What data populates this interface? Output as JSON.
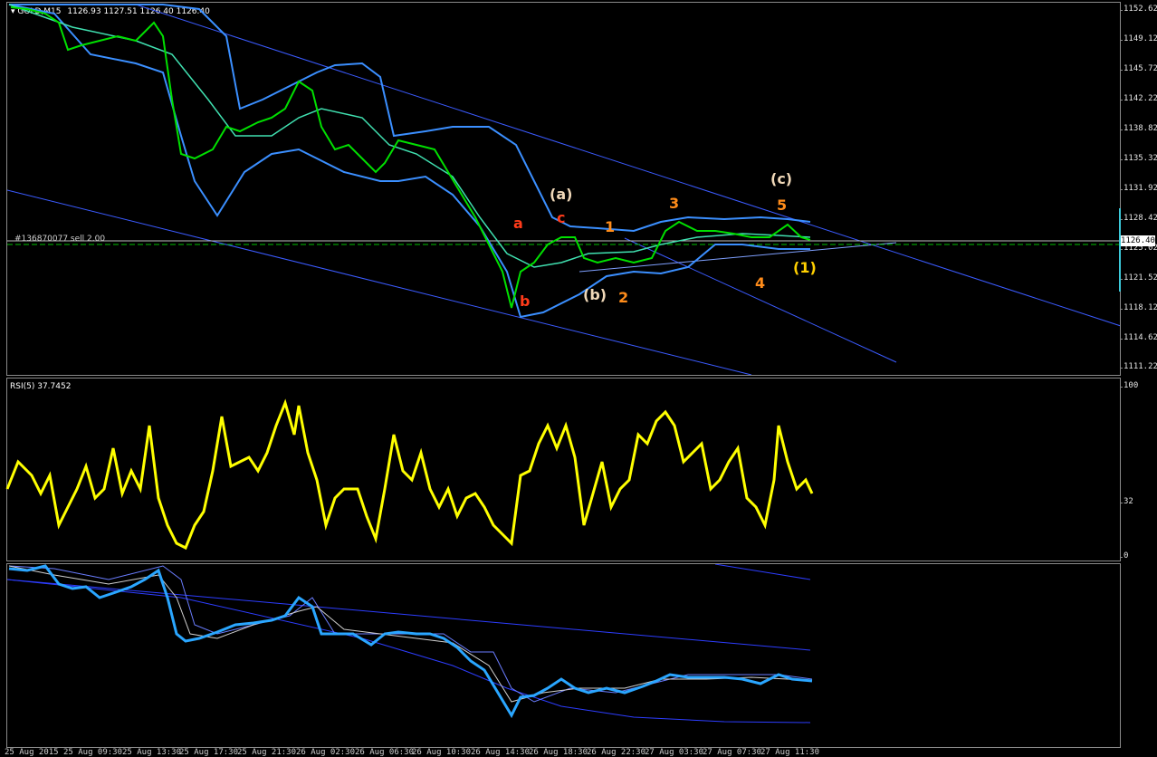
{
  "main": {
    "symbol": "GOLD,M15",
    "ohlc": "1126.93 1127.51 1126.40 1126.40",
    "order_label": "#136870077 sell 2.00",
    "current_price": "1126.40",
    "price_axis": [
      "1152.62",
      "1149.12",
      "1145.72",
      "1142.22",
      "1138.82",
      "1135.32",
      "1131.92",
      "1128.42",
      "1125.02",
      "1121.52",
      "1118.12",
      "1114.62",
      "1111.22"
    ]
  },
  "wave_labels": {
    "a_small": "a",
    "b_small": "b",
    "c_small": "c",
    "wave_a": "(a)",
    "wave_b": "(b)",
    "wave_c": "(c)",
    "wave_1": "(1)",
    "n1": "1",
    "n2": "2",
    "n3": "3",
    "n4": "4",
    "n5": "5"
  },
  "rsi": {
    "label": "RSI(5) 37.7452",
    "axis": [
      "100",
      "32",
      "0"
    ]
  },
  "time_axis": [
    "25 Aug 2015",
    "25 Aug 09:30",
    "25 Aug 13:30",
    "25 Aug 17:30",
    "25 Aug 21:30",
    "26 Aug 02:30",
    "26 Aug 06:30",
    "26 Aug 10:30",
    "26 Aug 14:30",
    "26 Aug 18:30",
    "26 Aug 22:30",
    "27 Aug 03:30",
    "27 Aug 07:30",
    "27 Aug 11:30"
  ],
  "colors": {
    "candles": "#00e000",
    "bollinger": "#3b8fff",
    "midline": "#40e0b0",
    "trend": "#3b5bff",
    "rsi": "#ffff00",
    "lower_line": "#2aa6ff",
    "wave_orange": "#ff8c1a",
    "wave_red": "#ff3b1a",
    "wave_white": "#f0d8b8"
  }
}
